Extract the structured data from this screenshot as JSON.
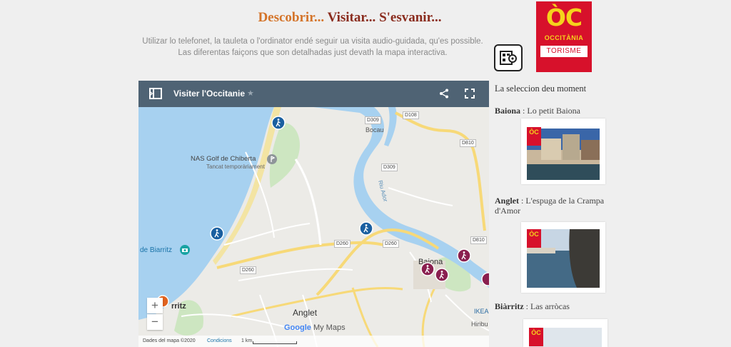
{
  "header": {
    "title_part1": "Descobrir...",
    "title_part2": "Visitar...",
    "title_part3": "S'esvanir...",
    "intro": "Utilizar lo telefonet, la tauleta o l'ordinator endé seguir ua visita audio-guidada, qu'es possible. Las diferentas faiçons que son detalhadas just devath la mapa interactiva."
  },
  "logo": {
    "main": "ÒC",
    "sub": "OCCITÀNIA",
    "tag": "TORISME"
  },
  "map": {
    "title": "Visiter l'Occitanie",
    "places": {
      "golf": "NAS Golf de Chiberta",
      "golf_status": "Tancat temporàriament",
      "bocau": "Bocau",
      "biarritz_left": "de Biarritz",
      "biarritz": "rritz",
      "anglet": "Anglet",
      "baiona": "Baiona",
      "hiribu": "Hiribu",
      "ikea": "IKEA",
      "riu": "Riu Ador"
    },
    "roads": [
      "D309",
      "D108",
      "D309",
      "D810",
      "D309",
      "D260",
      "D260",
      "D260",
      "D810"
    ],
    "footer": {
      "credit": "Dades del mapa ©2020",
      "conditions": "Condicions",
      "scale": "1 km",
      "google": "Google",
      "mymaps": "My Maps"
    },
    "zoom_in": "+",
    "zoom_out": "−"
  },
  "sidebar": {
    "heading": "La seleccion deu moment",
    "entries": [
      {
        "place": "Baiona",
        "sep": " : ",
        "text": "Lo petit Baiona"
      },
      {
        "place": "Anglet",
        "sep": " : ",
        "text": "L'espuga de la Crampa d'Amor"
      },
      {
        "place": "Biàrritz",
        "sep": " : ",
        "text": "Las arròcas"
      }
    ],
    "thumb_badge": "ÒC"
  },
  "colors": {
    "accent_orange": "#d4742a",
    "accent_brown": "#8a2c1e",
    "brand_red": "#d7112b",
    "brand_yellow": "#f5d31c",
    "map_header": "#4f6374"
  }
}
